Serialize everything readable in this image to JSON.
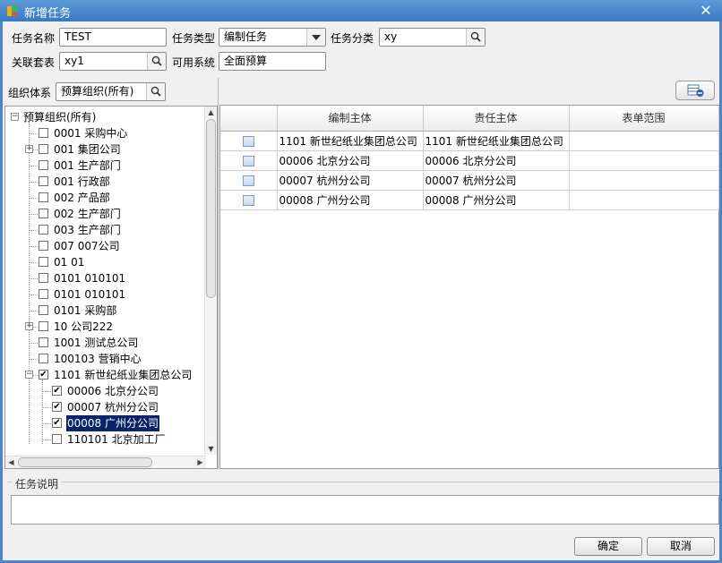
{
  "window": {
    "title": "新增任务"
  },
  "form": {
    "task_name_label": "任务名称",
    "task_name_value": "TEST",
    "task_type_label": "任务类型",
    "task_type_value": "编制任务",
    "task_category_label": "任务分类",
    "task_category_value": "xy",
    "linked_form_label": "关联套表",
    "linked_form_value": "xy1",
    "available_system_label": "可用系统",
    "available_system_value": "全面预算"
  },
  "org": {
    "label": "组织体系",
    "value": "预算组织(所有)"
  },
  "tree": {
    "root": "预算组织(所有)",
    "items": [
      {
        "text": "0001 采购中心",
        "expandable": false,
        "checked": false,
        "level": 1
      },
      {
        "text": "001 集团公司",
        "expandable": true,
        "checked": false,
        "level": 1
      },
      {
        "text": "001 生产部门",
        "expandable": false,
        "checked": false,
        "level": 1
      },
      {
        "text": "001 行政部",
        "expandable": false,
        "checked": false,
        "level": 1
      },
      {
        "text": "002 产品部",
        "expandable": false,
        "checked": false,
        "level": 1
      },
      {
        "text": "002 生产部门",
        "expandable": false,
        "checked": false,
        "level": 1
      },
      {
        "text": "003 生产部门",
        "expandable": false,
        "checked": false,
        "level": 1
      },
      {
        "text": "007 007公司",
        "expandable": false,
        "checked": false,
        "level": 1
      },
      {
        "text": "01 01",
        "expandable": false,
        "checked": false,
        "level": 1
      },
      {
        "text": "0101 010101",
        "expandable": false,
        "checked": false,
        "level": 1
      },
      {
        "text": "0101 010101",
        "expandable": false,
        "checked": false,
        "level": 1
      },
      {
        "text": "0101 采购部",
        "expandable": false,
        "checked": false,
        "level": 1
      },
      {
        "text": "10 公司222",
        "expandable": true,
        "checked": false,
        "level": 1
      },
      {
        "text": "1001 测试总公司",
        "expandable": false,
        "checked": false,
        "level": 1
      },
      {
        "text": "100103 营销中心",
        "expandable": false,
        "checked": false,
        "level": 1
      },
      {
        "text": "1101 新世纪纸业集团总公司",
        "expandable": true,
        "expanded": true,
        "checked": true,
        "level": 1
      },
      {
        "text": "00006 北京分公司",
        "expandable": false,
        "checked": true,
        "level": 2
      },
      {
        "text": "00007 杭州分公司",
        "expandable": false,
        "checked": true,
        "level": 2
      },
      {
        "text": "00008 广州分公司",
        "expandable": false,
        "checked": true,
        "level": 2,
        "selected": true
      },
      {
        "text": "110101 北京加工厂",
        "expandable": false,
        "checked": false,
        "level": 2
      }
    ]
  },
  "grid": {
    "columns": [
      "",
      "编制主体",
      "责任主体",
      "表单范围"
    ],
    "rows": [
      {
        "compile": "1101 新世纪纸业集团总公司",
        "responsible": "1101 新世纪纸业集团总公司",
        "scope": ""
      },
      {
        "compile": "00006 北京分公司",
        "responsible": "00006 北京分公司",
        "scope": ""
      },
      {
        "compile": "00007 杭州分公司",
        "responsible": "00007 杭州分公司",
        "scope": ""
      },
      {
        "compile": "00008 广州分公司",
        "responsible": "00008 广州分公司",
        "scope": ""
      }
    ]
  },
  "description": {
    "legend": "任务说明",
    "value": ""
  },
  "buttons": {
    "ok": "确定",
    "cancel": "取消"
  },
  "icons": {
    "app": "app-logo-icon",
    "close": "close-icon",
    "search": "search-icon",
    "dropdown": "chevron-down-icon",
    "remove_row": "remove-row-icon"
  },
  "colors": {
    "titlebar": "#4a86c8",
    "selection": "#0a246a",
    "panel": "#f0f0f0"
  }
}
